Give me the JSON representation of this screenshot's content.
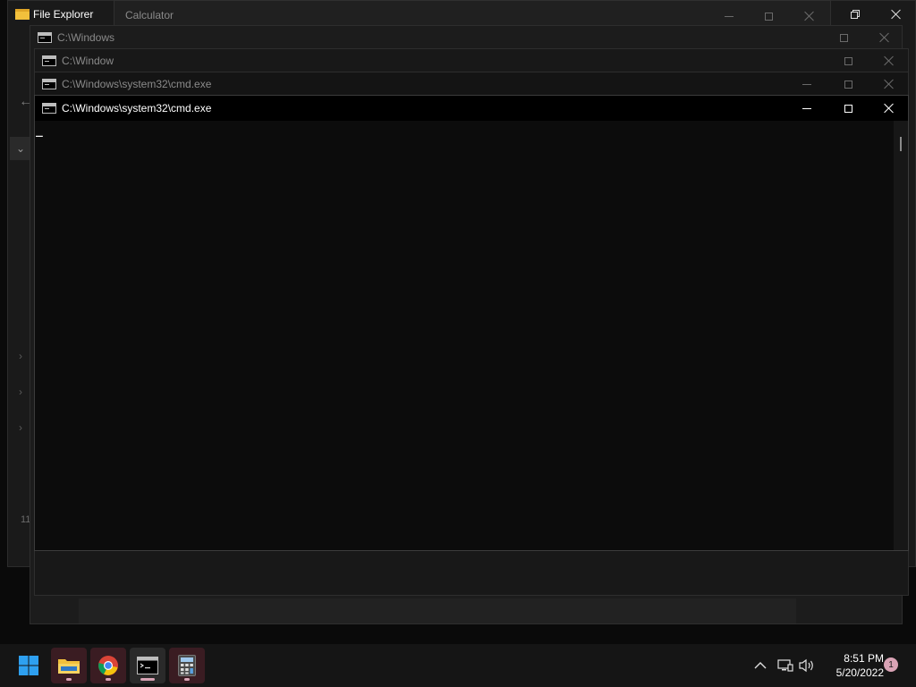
{
  "file_explorer": {
    "title": "File Explorer",
    "sidebar_footer": "11"
  },
  "calculator": {
    "title": "Calculator"
  },
  "background_cmd_1": {
    "title": "C:\\Windows"
  },
  "background_cmd_2": {
    "title": "C:\\Window"
  },
  "background_cmd_3": {
    "title": "C:\\Windows\\system32\\cmd.exe"
  },
  "active_cmd": {
    "title": "C:\\Windows\\system32\\cmd.exe",
    "cursor": "_"
  },
  "taskbar": {
    "apps": [
      "start",
      "file-explorer",
      "chrome",
      "terminal",
      "calculator"
    ],
    "clock_time": "8:51 PM",
    "clock_date": "5/20/2022",
    "notification_count": "1"
  },
  "colors": {
    "accent": "#d9a3b5",
    "terminal_bg": "#0c0c0c",
    "start_blue": "#2ea0f0"
  }
}
